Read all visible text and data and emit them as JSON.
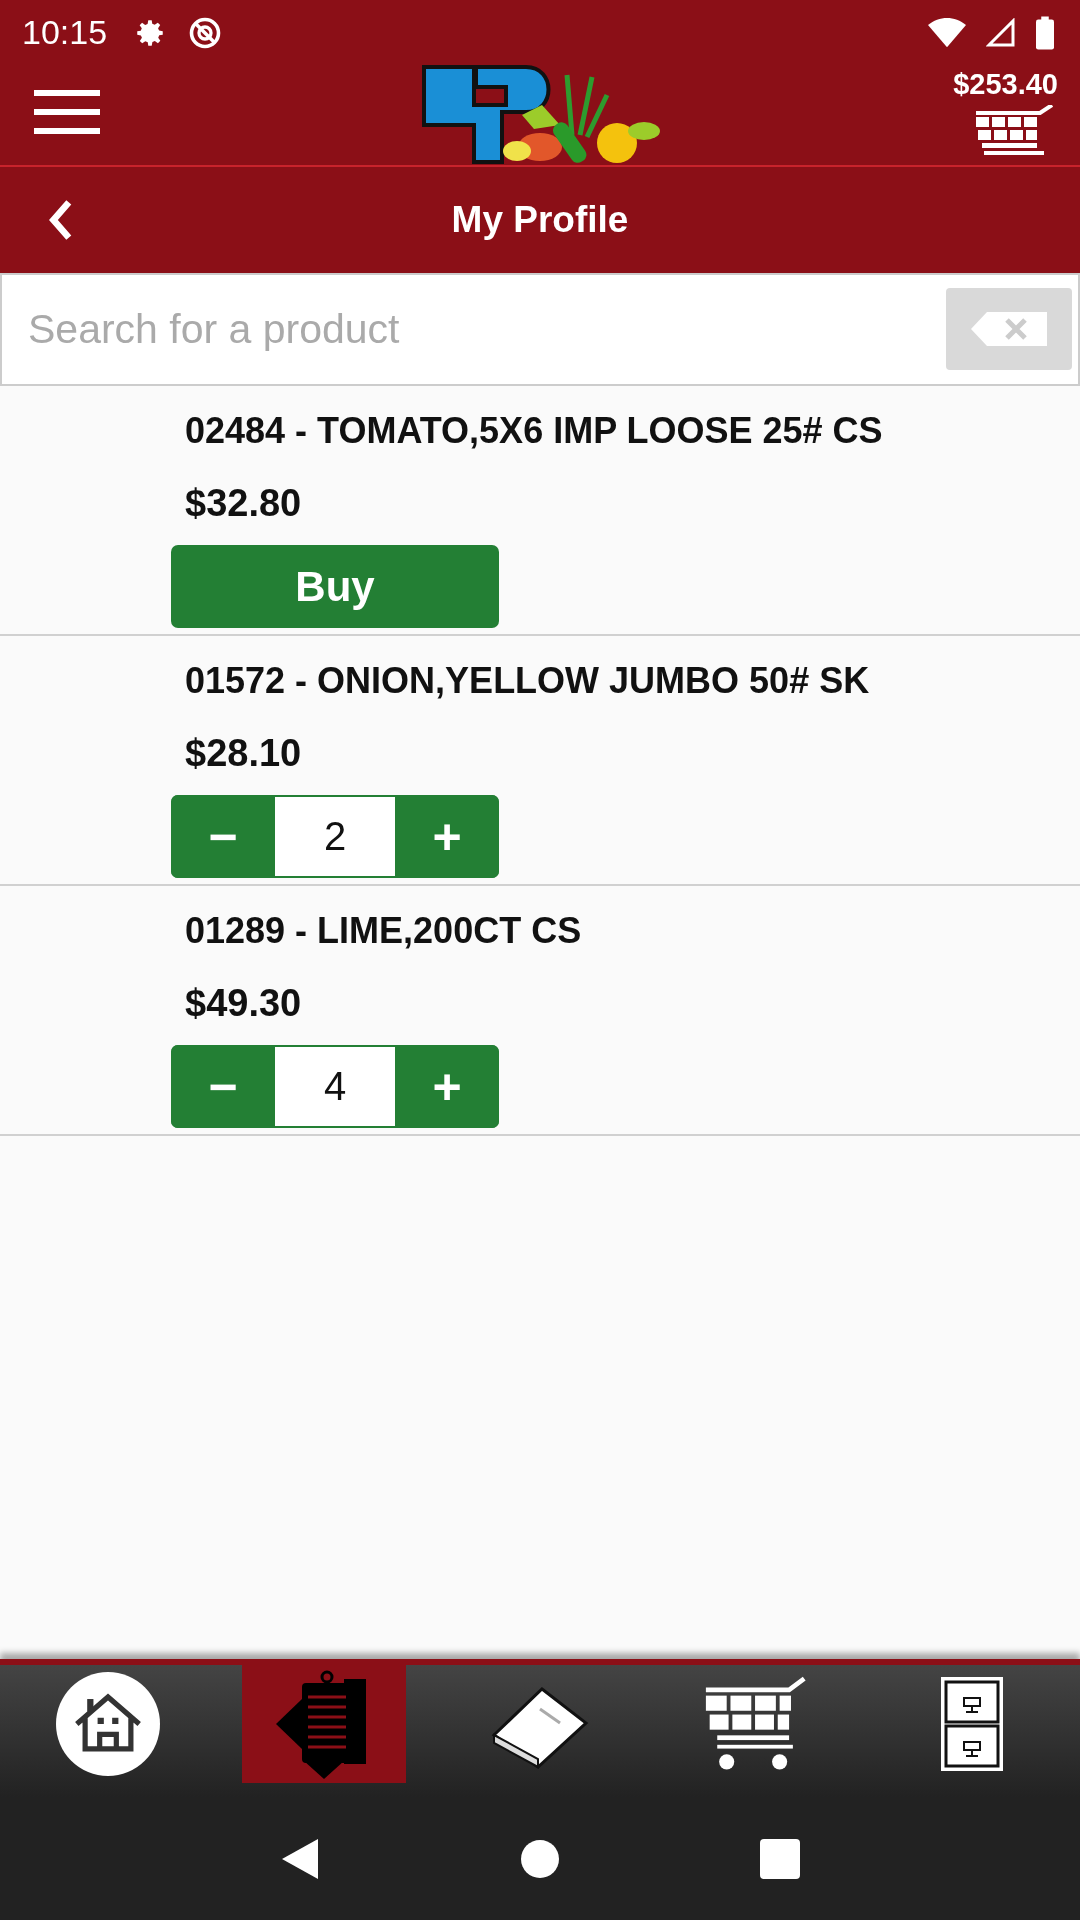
{
  "status_bar": {
    "time": "10:15"
  },
  "app_bar": {
    "cart_total": "$253.40"
  },
  "title_bar": {
    "title": "My Profile"
  },
  "search": {
    "placeholder": "Search for a product"
  },
  "products": [
    {
      "kind": "buy",
      "name": "02484 - TOMATO,5X6 IMP LOOSE 25# CS",
      "price": "$32.80",
      "button": "Buy"
    },
    {
      "kind": "stepper",
      "name": "01572 - ONION,YELLOW JUMBO 50# SK",
      "price": "$28.10",
      "minus": "−",
      "quantity": "2",
      "plus": "+"
    },
    {
      "kind": "stepper",
      "name": "01289 - LIME,200CT CS",
      "price": "$49.30",
      "minus": "−",
      "quantity": "4",
      "plus": "+"
    }
  ],
  "bottom_nav": [
    {
      "kind": "home",
      "selected": false
    },
    {
      "kind": "order",
      "selected": true
    },
    {
      "kind": "catalog",
      "selected": false
    },
    {
      "kind": "cart",
      "selected": false
    },
    {
      "kind": "cabinet",
      "selected": false
    }
  ]
}
